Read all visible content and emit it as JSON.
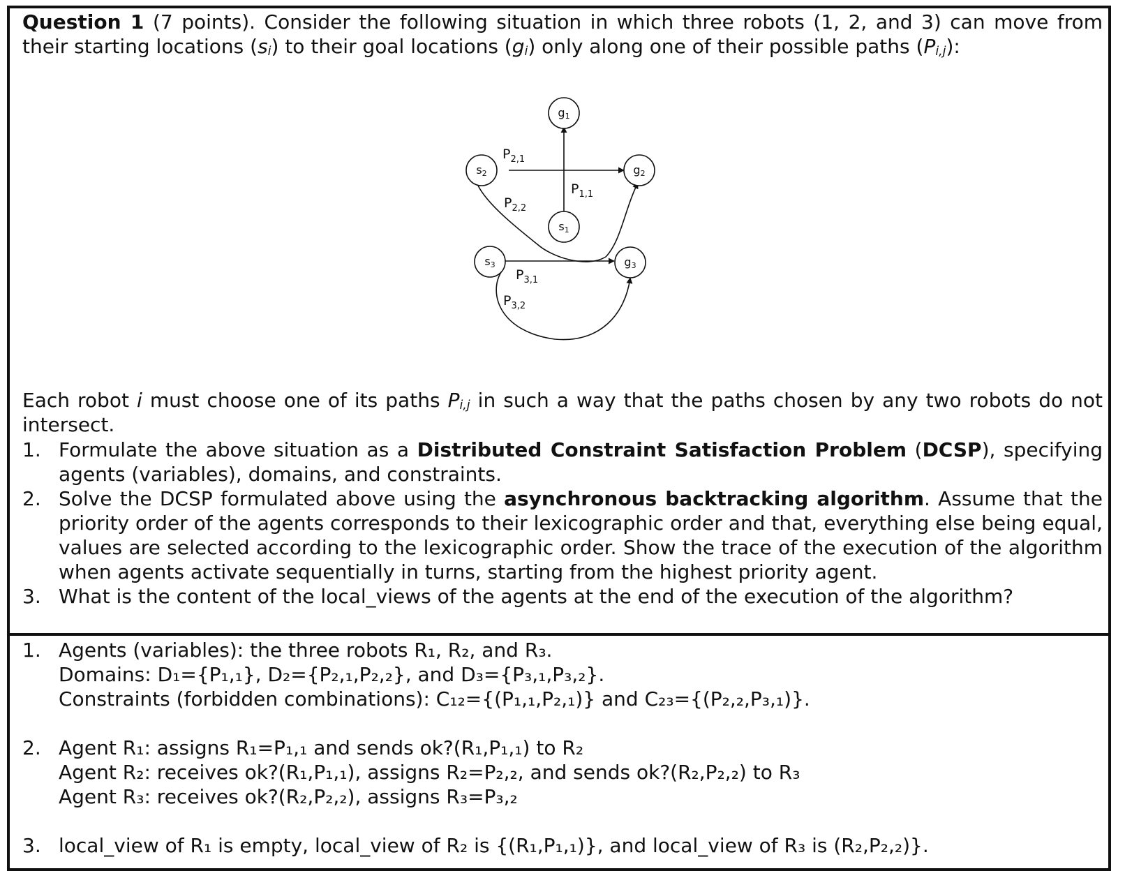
{
  "question": {
    "heading": "Question 1",
    "points": "(7 points)",
    "intro_rest": ". Consider the following situation in which three robots (1, 2, and 3) can move from their starting locations (",
    "s": "s",
    "i": "i",
    "mid1": ") to their goal locations (",
    "g": "g",
    "mid2": ") only along one of their possible paths (",
    "P": "P",
    "ij": "i,j",
    "end": "):",
    "each_robot": "Each robot ",
    "each_mid": " must choose one of its paths ",
    "each_end": " in such a way that the paths chosen by any two robots do not intersect.",
    "items": [
      {
        "num": "1.",
        "a": "Formulate the above situation as a ",
        "bold": "Distributed Constraint Satisfaction Problem",
        "b": " (",
        "bold2": "DCSP",
        "c": "), specifying agents (variables), domains, and constraints."
      },
      {
        "num": "2.",
        "a": "Solve the DCSP formulated above using the ",
        "bold": "asynchronous backtracking algorithm",
        "c": ". Assume that the priority order of the agents corresponds to their lexicographic order and that, everything else being equal, values are selected according to the lexicographic order. Show the trace of the execution of the algorithm when agents activate sequentially in turns, starting from the highest priority agent."
      },
      {
        "num": "3.",
        "a": "What is the content of the local_views of the agents at the end of the execution of the algorithm?"
      }
    ]
  },
  "diagram": {
    "nodes": {
      "g1": "g",
      "g2": "g",
      "g3": "g",
      "s1": "s",
      "s2": "s",
      "s3": "s"
    },
    "node_subs": {
      "g1": "1",
      "g2": "2",
      "g3": "3",
      "s1": "1",
      "s2": "2",
      "s3": "3"
    },
    "labels": {
      "p21": "P",
      "p22": "P",
      "p11": "P",
      "p31": "P",
      "p32": "P"
    },
    "label_subs": {
      "p21": "2,1",
      "p22": "2,2",
      "p11": "1,1",
      "p31": "3,1",
      "p32": "3,2"
    }
  },
  "answer": {
    "n1": "1.",
    "n2": "2.",
    "n3": "3.",
    "agents_line": "Agents (variables): the three robots R₁, R₂, and R₃.",
    "domains_line": "Domains: D₁={P₁,₁}, D₂={P₂,₁,P₂,₂}, and D₃={P₃,₁,P₃,₂}.",
    "constraints_line": "Constraints (forbidden combinations): C₁₂={(P₁,₁,P₂,₁)} and C₂₃={(P₂,₂,P₃,₁)}.",
    "trace1": "Agent R₁: assigns R₁=P₁,₁ and sends ok?(R₁,P₁,₁) to R₂",
    "trace2": "Agent R₂: receives ok?(R₁,P₁,₁), assigns R₂=P₂,₂, and sends ok?(R₂,P₂,₂) to R₃",
    "trace3": "Agent R₃: receives ok?(R₂,P₂,₂), assigns R₃=P₃,₂",
    "local_views": "local_view of R₁ is empty, local_view of R₂ is {(R₁,P₁,₁)}, and local_view of R₃ is (R₂,P₂,₂)}."
  }
}
